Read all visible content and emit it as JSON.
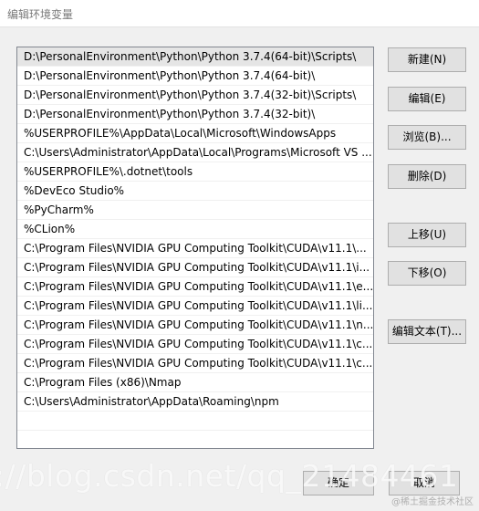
{
  "window": {
    "title": "编辑环境变量"
  },
  "path_list": {
    "items": [
      "D:\\PersonalEnvironment\\Python\\Python 3.7.4(64-bit)\\Scripts\\",
      "D:\\PersonalEnvironment\\Python\\Python 3.7.4(64-bit)\\",
      "D:\\PersonalEnvironment\\Python\\Python 3.7.4(32-bit)\\Scripts\\",
      "D:\\PersonalEnvironment\\Python\\Python 3.7.4(32-bit)\\",
      "%USERPROFILE%\\AppData\\Local\\Microsoft\\WindowsApps",
      "C:\\Users\\Administrator\\AppData\\Local\\Programs\\Microsoft VS ...",
      "%USERPROFILE%\\.dotnet\\tools",
      "%DevEco Studio%",
      "%PyCharm%",
      "%CLion%",
      "C:\\Program Files\\NVIDIA GPU Computing Toolkit\\CUDA\\v11.1\\...",
      "C:\\Program Files\\NVIDIA GPU Computing Toolkit\\CUDA\\v11.1\\i...",
      "C:\\Program Files\\NVIDIA GPU Computing Toolkit\\CUDA\\v11.1\\e...",
      "C:\\Program Files\\NVIDIA GPU Computing Toolkit\\CUDA\\v11.1\\li...",
      "C:\\Program Files\\NVIDIA GPU Computing Toolkit\\CUDA\\v11.1\\n...",
      "C:\\Program Files\\NVIDIA GPU Computing Toolkit\\CUDA\\v11.1\\c...",
      "C:\\Program Files\\NVIDIA GPU Computing Toolkit\\CUDA\\v11.1\\c...",
      "C:\\Program Files (x86)\\Nmap",
      "C:\\Users\\Administrator\\AppData\\Roaming\\npm"
    ],
    "selected_index": 0
  },
  "buttons": {
    "new": "新建(N)",
    "edit": "编辑(E)",
    "browse": "浏览(B)...",
    "delete": "删除(D)",
    "move_up": "上移(U)",
    "move_down": "下移(O)",
    "edit_text": "编辑文本(T)...",
    "ok": "确定",
    "cancel": "取消"
  },
  "watermark": {
    "text": "://blog.csdn.net/qq_21484461",
    "juejin": "@稀土掘金技术社区"
  },
  "colors": {
    "dialog_bg": "#f0f0f0",
    "list_bg": "#ffffff",
    "selected_row": "#e5e5e5",
    "button_bg": "#e1e1e1",
    "button_border": "#adadad"
  }
}
